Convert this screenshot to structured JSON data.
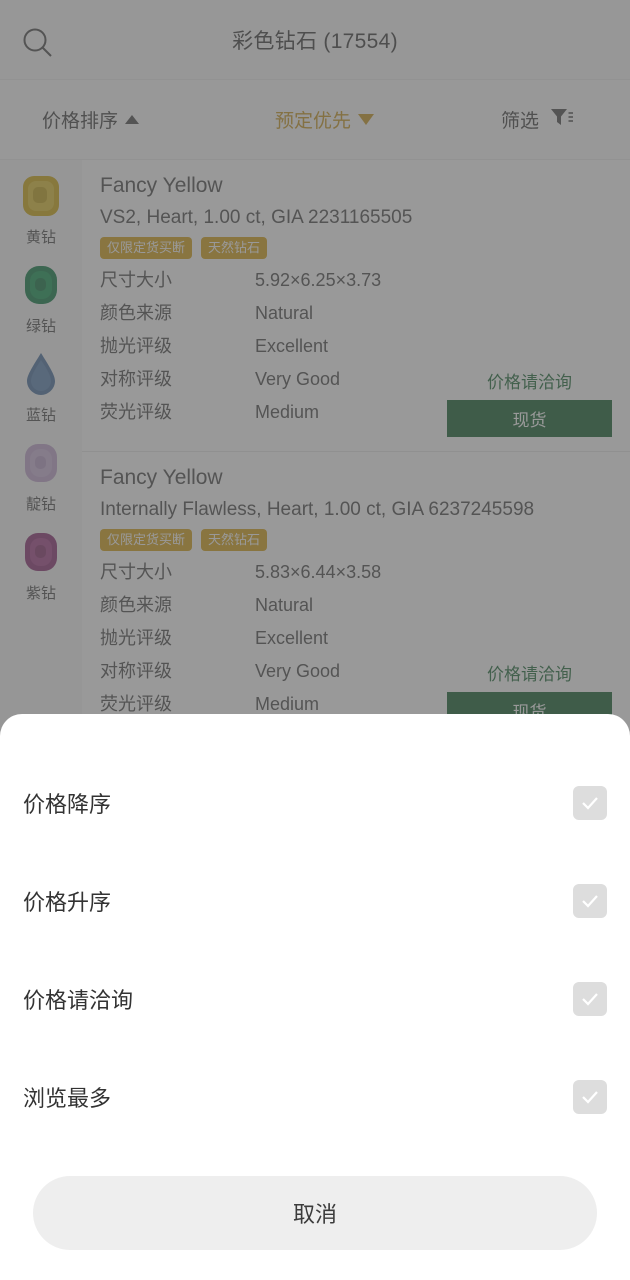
{
  "header": {
    "title": "彩色钻石 (17554)",
    "search_icon": "search-icon"
  },
  "sortbar": {
    "items": [
      {
        "label": "价格排序",
        "arrow": "▲",
        "active": false
      },
      {
        "label": "预定优先",
        "arrow": "▼",
        "active": true
      },
      {
        "label": "筛选",
        "icon": "filter-icon"
      }
    ],
    "active_color": "#c8961e"
  },
  "sidebar": {
    "items": [
      {
        "label": "黄钻",
        "color": "#d4af12",
        "shape": "cushion"
      },
      {
        "label": "绿钻",
        "color": "#0f7a42",
        "shape": "cushion"
      },
      {
        "label": "蓝钻",
        "color": "#3f6fa8",
        "shape": "pear"
      },
      {
        "label": "靛钻",
        "color": "#c0a0cf",
        "shape": "cushion"
      },
      {
        "label": "紫钻",
        "color": "#8c2f74",
        "shape": "cushion"
      }
    ]
  },
  "spec_keys": [
    "尺寸大小",
    "颜色来源",
    "抛光评级",
    "对称评级",
    "荧光评级"
  ],
  "products": [
    {
      "title": "Fancy Yellow",
      "subtitle": "VS2, Heart, 1.00 ct, GIA 2231165505",
      "tags": [
        "仅限定货买断",
        "天然钻石"
      ],
      "specs": [
        "5.92×6.25×3.73",
        "Natural",
        "Excellent",
        "Very Good",
        "Medium"
      ],
      "price_note": "价格请洽询",
      "stock_label": "现货"
    },
    {
      "title": "Fancy Yellow",
      "subtitle": "Internally Flawless, Heart, 1.00 ct, GIA 6237245598",
      "tags": [
        "仅限定货买断",
        "天然钻石"
      ],
      "specs": [
        "5.83×6.44×3.58",
        "Natural",
        "Excellent",
        "Very Good",
        "Medium"
      ],
      "price_note": "价格请洽询",
      "stock_label": "现货"
    }
  ],
  "sheet": {
    "options": [
      {
        "label": "价格降序",
        "checked": false
      },
      {
        "label": "价格升序",
        "checked": false
      },
      {
        "label": "价格请洽询",
        "checked": false
      },
      {
        "label": "浏览最多",
        "checked": false
      }
    ],
    "cancel_label": "取消",
    "checkbox_color": "#dddddd"
  }
}
